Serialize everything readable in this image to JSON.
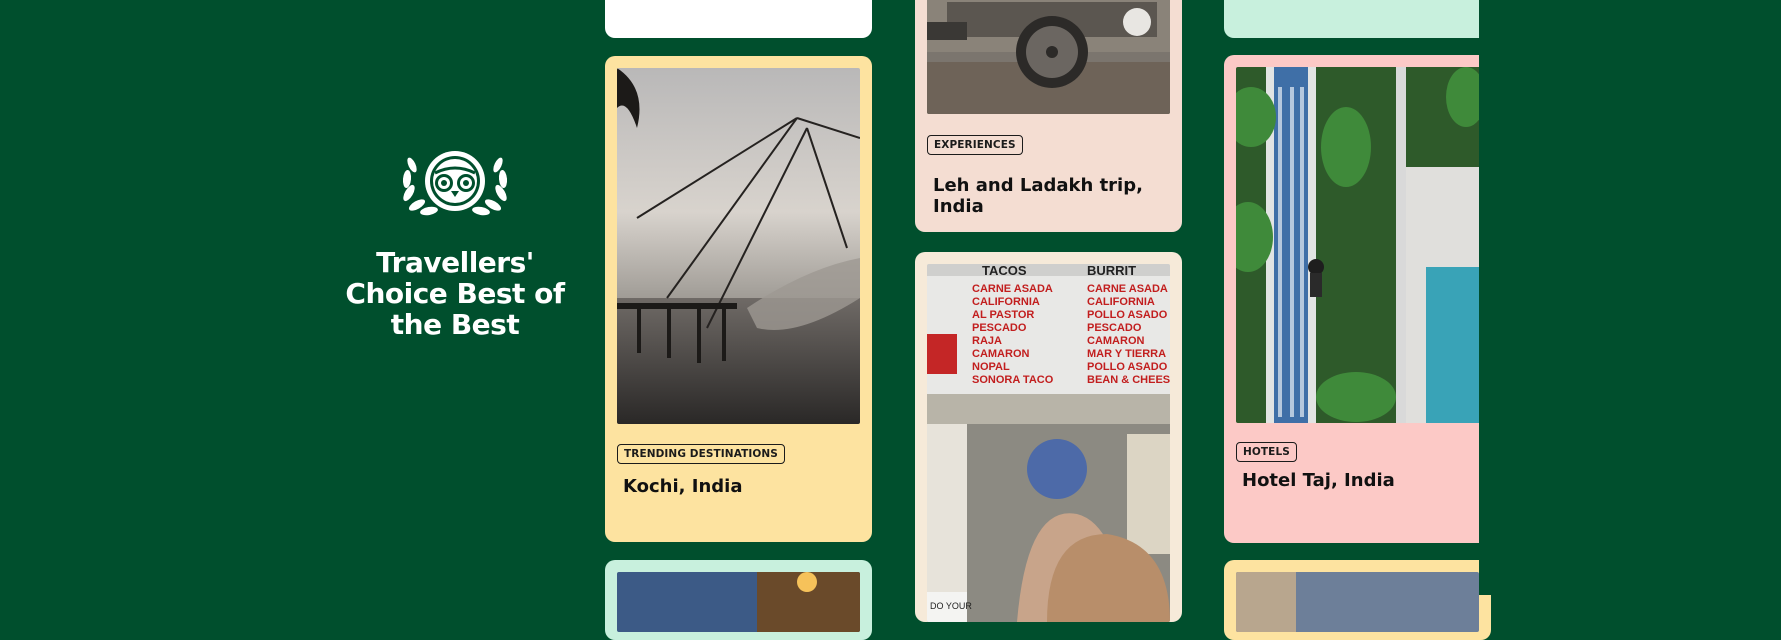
{
  "brand": {
    "icon": "owl-laurel-icon",
    "title_line1": "Travellers'",
    "title_line2": "Choice Best of",
    "title_line3": "the Best"
  },
  "cards": {
    "kochi": {
      "badge": "TRENDING DESTINATIONS",
      "title": "Kochi, India",
      "bg": "#fde3a0"
    },
    "leh": {
      "badge": "EXPERIENCES",
      "title": "Leh and Ladakh trip, India",
      "bg": "#f4ddd2"
    },
    "taj": {
      "badge": "HOTELS",
      "title": "Hotel Taj, India",
      "bg": "#fcc9c6"
    }
  },
  "menu_board": {
    "header_left": "TACOS",
    "header_right": "BURRIT",
    "items_left": [
      "CARNE ASADA",
      "CALIFORNIA",
      "AL PASTOR",
      "PESCADO",
      "RAJA",
      "CAMARON",
      "NOPAL",
      "SONORA TACO"
    ],
    "items_right": [
      "CARNE ASADA",
      "CALIFORNIA",
      "POLLO ASADO",
      "PESCADO",
      "CAMARON",
      "MAR Y TIERRA",
      "POLLO ASADO",
      "BEAN & CHEESE"
    ],
    "bottom_sign": "DO YOUR"
  },
  "colors": {
    "background": "#004f2d",
    "card_white": "#ffffff",
    "card_mint": "#c8f0dd",
    "card_cream": "#f6ead9"
  }
}
